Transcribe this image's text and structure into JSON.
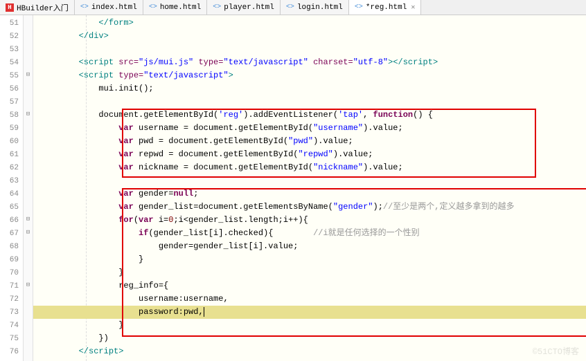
{
  "tabs": [
    {
      "label": "HBuilder入门",
      "icon": "H",
      "iconColor": "#e03030",
      "active": false
    },
    {
      "label": "index.html",
      "icon": "<>",
      "iconColor": "#4a90d9",
      "active": false
    },
    {
      "label": "home.html",
      "icon": "<>",
      "iconColor": "#4a90d9",
      "active": false
    },
    {
      "label": "player.html",
      "icon": "<>",
      "iconColor": "#4a90d9",
      "active": false
    },
    {
      "label": "login.html",
      "icon": "<>",
      "iconColor": "#4a90d9",
      "active": false
    },
    {
      "label": "*reg.html",
      "icon": "<>",
      "iconColor": "#4a90d9",
      "active": true,
      "closable": true
    }
  ],
  "gutter": {
    "start": 51,
    "end": 76,
    "folds": {
      "55": "⊟",
      "58": "⊟",
      "66": "⊟",
      "67": "⊟",
      "71": "⊟"
    }
  },
  "highlight_line": 73,
  "watermark": "©51CTO博客",
  "code": {
    "l51": {
      "indent": "            ",
      "tag_close_form": "</form>"
    },
    "l52": {
      "indent": "        ",
      "tag_close_div": "</div>"
    },
    "l53": {
      "indent": ""
    },
    "l54": {
      "indent": "        ",
      "open": "<script ",
      "a_src": "src=",
      "v_src": "\"js/mui.js\"",
      "a_type": " type=",
      "v_type": "\"text/javascript\"",
      "a_charset": " charset=",
      "v_charset": "\"utf-8\"",
      "close_open": ">",
      "close": "</script>"
    },
    "l55": {
      "indent": "        ",
      "open": "<script ",
      "a_type": "type=",
      "v_type": "\"text/javascript\"",
      "close": ">"
    },
    "l56": {
      "indent": "            ",
      "txt": "mui.init();"
    },
    "l57": {
      "indent": ""
    },
    "l58": {
      "indent": "            ",
      "p1": "document",
      "p2": ".getElementById(",
      "s1": "'reg'",
      "p3": ").addEventListener(",
      "s2": "'tap'",
      "p4": ", ",
      "kw": "function",
      "p5": "() {"
    },
    "l59": {
      "indent": "                ",
      "kw": "var",
      "p1": " username = ",
      "p2": "document",
      "p3": ".getElementById(",
      "s": "\"username\"",
      "p4": ").value;"
    },
    "l60": {
      "indent": "                ",
      "kw": "var",
      "p1": " pwd = ",
      "p2": "document",
      "p3": ".getElementById(",
      "s": "\"pwd\"",
      "p4": ").value;"
    },
    "l61": {
      "indent": "                ",
      "kw": "var",
      "p1": " repwd = ",
      "p2": "document",
      "p3": ".getElementById(",
      "s": "\"repwd\"",
      "p4": ").value;"
    },
    "l62": {
      "indent": "                ",
      "kw": "var",
      "p1": " nickname = ",
      "p2": "document",
      "p3": ".getElementById(",
      "s": "\"nickname\"",
      "p4": ").value;"
    },
    "l63": {
      "indent": ""
    },
    "l64": {
      "indent": "                ",
      "kw": "var",
      "p1": " gender=",
      "kw2": "null",
      "p2": ";"
    },
    "l65": {
      "indent": "                ",
      "kw": "var",
      "p1": " gender_list=",
      "p2": "document",
      "p3": ".getElementsByName(",
      "s": "\"gender\"",
      "p4": ");",
      "com": "//至少是两个,定义越多拿到的越多"
    },
    "l66": {
      "indent": "                ",
      "kw": "for",
      "p1": "(",
      "kw2": "var",
      "p2": " i=",
      "n": "0",
      "p3": ";i<gender_list.length;i++){"
    },
    "l67": {
      "indent": "                    ",
      "kw": "if",
      "p1": "(gender_list[i].checked){",
      "sp": "        ",
      "com": "//i就是任何选择的一个性别"
    },
    "l68": {
      "indent": "                        ",
      "p1": "gender=gender_list[i].value;"
    },
    "l69": {
      "indent": "                    ",
      "p1": "}"
    },
    "l70": {
      "indent": "                ",
      "p1": "}"
    },
    "l71": {
      "indent": "                ",
      "p1": "reg_info={"
    },
    "l72": {
      "indent": "                    ",
      "p1": "username:username,"
    },
    "l73": {
      "indent": "                    ",
      "p1": "password:pwd,"
    },
    "l74": {
      "indent": "                ",
      "p1": "}"
    },
    "l75": {
      "indent": "            ",
      "p1": "})"
    },
    "l76": {
      "indent": "        ",
      "close": "</script>"
    }
  }
}
